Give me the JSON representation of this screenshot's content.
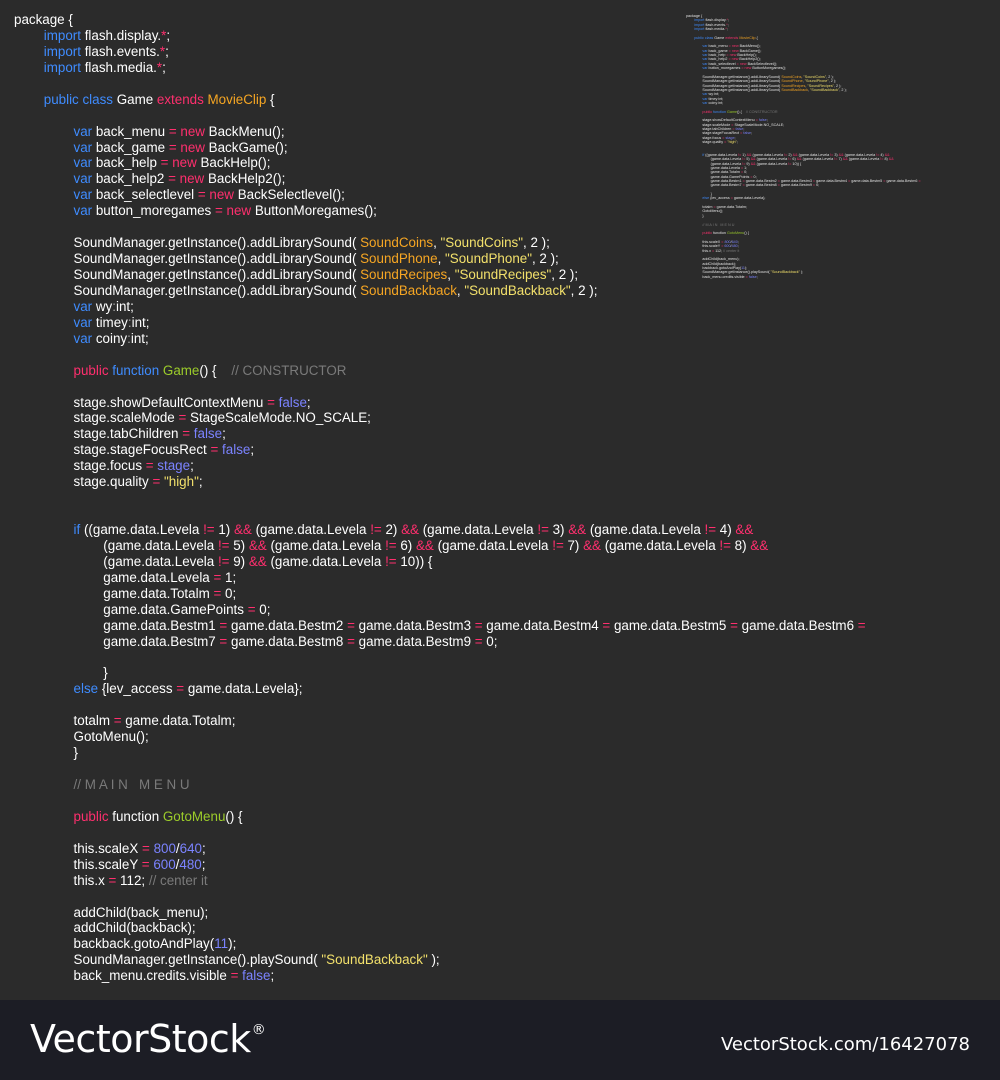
{
  "colors": {
    "background": "#2b2b2b",
    "keyword": "#3f8cff",
    "operator": "#ff2f6e",
    "classname": "#f6a623",
    "function_name": "#9ccc2a",
    "string": "#f2e06b",
    "number": "#7b83ff",
    "comment": "#7a7a7a",
    "footer": "#1c1d25"
  },
  "code_lines": [
    [
      [
        "t",
        "package {"
      ]
    ],
    [
      [
        "t",
        "        "
      ],
      [
        "k",
        "import"
      ],
      [
        "t",
        " flash.display."
      ],
      [
        "m",
        "*"
      ],
      [
        "t",
        ";"
      ]
    ],
    [
      [
        "t",
        "        "
      ],
      [
        "k",
        "import"
      ],
      [
        "t",
        " flash.events."
      ],
      [
        "m",
        "*"
      ],
      [
        "t",
        ";"
      ]
    ],
    [
      [
        "t",
        "        "
      ],
      [
        "k",
        "import"
      ],
      [
        "t",
        " flash.media."
      ],
      [
        "m",
        "*"
      ],
      [
        "t",
        ";"
      ]
    ],
    [
      [
        "t",
        ""
      ]
    ],
    [
      [
        "t",
        "        "
      ],
      [
        "k",
        "public class"
      ],
      [
        "t",
        " Game "
      ],
      [
        "m",
        "extends"
      ],
      [
        "t",
        " "
      ],
      [
        "c",
        "MovieClip"
      ],
      [
        "t",
        " {"
      ]
    ],
    [
      [
        "t",
        ""
      ]
    ],
    [
      [
        "t",
        "                "
      ],
      [
        "k",
        "var"
      ],
      [
        "t",
        " back_menu "
      ],
      [
        "m",
        "="
      ],
      [
        "t",
        " "
      ],
      [
        "m",
        "new"
      ],
      [
        "t",
        " BackMenu();"
      ]
    ],
    [
      [
        "t",
        "                "
      ],
      [
        "k",
        "var"
      ],
      [
        "t",
        " back_game "
      ],
      [
        "m",
        "="
      ],
      [
        "t",
        " "
      ],
      [
        "m",
        "new"
      ],
      [
        "t",
        " BackGame();"
      ]
    ],
    [
      [
        "t",
        "                "
      ],
      [
        "k",
        "var"
      ],
      [
        "t",
        " back_help "
      ],
      [
        "m",
        "="
      ],
      [
        "t",
        " "
      ],
      [
        "m",
        "new"
      ],
      [
        "t",
        " BackHelp();"
      ]
    ],
    [
      [
        "t",
        "                "
      ],
      [
        "k",
        "var"
      ],
      [
        "t",
        " back_help2 "
      ],
      [
        "m",
        "="
      ],
      [
        "t",
        " "
      ],
      [
        "m",
        "new"
      ],
      [
        "t",
        " BackHelp2();"
      ]
    ],
    [
      [
        "t",
        "                "
      ],
      [
        "k",
        "var"
      ],
      [
        "t",
        " back_selectlevel "
      ],
      [
        "m",
        "="
      ],
      [
        "t",
        " "
      ],
      [
        "m",
        "new"
      ],
      [
        "t",
        " BackSelectlevel();"
      ]
    ],
    [
      [
        "t",
        "                "
      ],
      [
        "k",
        "var"
      ],
      [
        "t",
        " button_moregames "
      ],
      [
        "m",
        "="
      ],
      [
        "t",
        " "
      ],
      [
        "m",
        "new"
      ],
      [
        "t",
        " ButtonMoregames();"
      ]
    ],
    [
      [
        "t",
        ""
      ]
    ],
    [
      [
        "t",
        "                SoundManager.getInstance().addLibrarySound( "
      ],
      [
        "c",
        "SoundCoins"
      ],
      [
        "t",
        ", "
      ],
      [
        "s",
        "\"SoundCoins\""
      ],
      [
        "t",
        ", 2 );"
      ]
    ],
    [
      [
        "t",
        "                SoundManager.getInstance().addLibrarySound( "
      ],
      [
        "c",
        "SoundPhone"
      ],
      [
        "t",
        ", "
      ],
      [
        "s",
        "\"SoundPhone\""
      ],
      [
        "t",
        ", 2 );"
      ]
    ],
    [
      [
        "t",
        "                SoundManager.getInstance().addLibrarySound( "
      ],
      [
        "c",
        "SoundRecipes"
      ],
      [
        "t",
        ", "
      ],
      [
        "s",
        "\"SoundRecipes\""
      ],
      [
        "t",
        ", 2 );"
      ]
    ],
    [
      [
        "t",
        "                SoundManager.getInstance().addLibrarySound( "
      ],
      [
        "c",
        "SoundBackback"
      ],
      [
        "t",
        ", "
      ],
      [
        "s",
        "\"SoundBackback\""
      ],
      [
        "t",
        ", 2 );"
      ]
    ],
    [
      [
        "t",
        "                "
      ],
      [
        "k",
        "var"
      ],
      [
        "t",
        " wy"
      ],
      [
        "i",
        ":"
      ],
      [
        "t",
        "int;"
      ]
    ],
    [
      [
        "t",
        "                "
      ],
      [
        "k",
        "var"
      ],
      [
        "t",
        " timey"
      ],
      [
        "i",
        ":"
      ],
      [
        "t",
        "int;"
      ]
    ],
    [
      [
        "t",
        "                "
      ],
      [
        "k",
        "var"
      ],
      [
        "t",
        " coiny"
      ],
      [
        "i",
        ":"
      ],
      [
        "t",
        "int;"
      ]
    ],
    [
      [
        "t",
        ""
      ]
    ],
    [
      [
        "t",
        "                "
      ],
      [
        "m",
        "public"
      ],
      [
        "t",
        " "
      ],
      [
        "k",
        "function"
      ],
      [
        "t",
        " "
      ],
      [
        "g",
        "Game"
      ],
      [
        "t",
        "() {    "
      ],
      [
        "cm",
        "// CONSTRUCTOR"
      ]
    ],
    [
      [
        "t",
        ""
      ]
    ],
    [
      [
        "t",
        "                stage.showDefaultContextMenu "
      ],
      [
        "m",
        "="
      ],
      [
        "t",
        " "
      ],
      [
        "n",
        "false"
      ],
      [
        "t",
        ";"
      ]
    ],
    [
      [
        "t",
        "                stage.scaleMode "
      ],
      [
        "m",
        "="
      ],
      [
        "t",
        " StageScaleMode.NO_SCALE;"
      ]
    ],
    [
      [
        "t",
        "                stage.tabChildren "
      ],
      [
        "m",
        "="
      ],
      [
        "t",
        " "
      ],
      [
        "n",
        "false"
      ],
      [
        "t",
        ";"
      ]
    ],
    [
      [
        "t",
        "                stage.stageFocusRect "
      ],
      [
        "m",
        "="
      ],
      [
        "t",
        " "
      ],
      [
        "n",
        "false"
      ],
      [
        "t",
        ";"
      ]
    ],
    [
      [
        "t",
        "                stage.focus "
      ],
      [
        "m",
        "="
      ],
      [
        "t",
        " "
      ],
      [
        "n",
        "stage"
      ],
      [
        "t",
        ";"
      ]
    ],
    [
      [
        "t",
        "                stage.quality "
      ],
      [
        "m",
        "="
      ],
      [
        "t",
        " "
      ],
      [
        "s",
        "\"high\""
      ],
      [
        "t",
        ";"
      ]
    ],
    [
      [
        "t",
        ""
      ]
    ],
    [
      [
        "t",
        ""
      ]
    ],
    [
      [
        "t",
        "                "
      ],
      [
        "k",
        "if"
      ],
      [
        "t",
        " ((game.data.Levela "
      ],
      [
        "m",
        "!="
      ],
      [
        "t",
        " 1) "
      ],
      [
        "m",
        "&&"
      ],
      [
        "t",
        " (game.data.Levela "
      ],
      [
        "m",
        "!="
      ],
      [
        "t",
        " 2) "
      ],
      [
        "m",
        "&&"
      ],
      [
        "t",
        " (game.data.Levela "
      ],
      [
        "m",
        "!="
      ],
      [
        "t",
        " 3) "
      ],
      [
        "m",
        "&&"
      ],
      [
        "t",
        " (game.data.Levela "
      ],
      [
        "m",
        "!="
      ],
      [
        "t",
        " 4) "
      ],
      [
        "m",
        "&&"
      ]
    ],
    [
      [
        "t",
        "                        (game.data.Levela "
      ],
      [
        "m",
        "!="
      ],
      [
        "t",
        " 5) "
      ],
      [
        "m",
        "&&"
      ],
      [
        "t",
        " (game.data.Levela "
      ],
      [
        "m",
        "!="
      ],
      [
        "t",
        " 6) "
      ],
      [
        "m",
        "&&"
      ],
      [
        "t",
        " (game.data.Levela "
      ],
      [
        "m",
        "!="
      ],
      [
        "t",
        " 7) "
      ],
      [
        "m",
        "&&"
      ],
      [
        "t",
        " (game.data.Levela "
      ],
      [
        "m",
        "!="
      ],
      [
        "t",
        " 8) "
      ],
      [
        "m",
        "&&"
      ]
    ],
    [
      [
        "t",
        "                        (game.data.Levela "
      ],
      [
        "m",
        "!="
      ],
      [
        "t",
        " 9) "
      ],
      [
        "m",
        "&&"
      ],
      [
        "t",
        " (game.data.Levela "
      ],
      [
        "m",
        "!="
      ],
      [
        "t",
        " 10)) {"
      ]
    ],
    [
      [
        "t",
        "                        game.data.Levela "
      ],
      [
        "m",
        "="
      ],
      [
        "t",
        " 1;"
      ]
    ],
    [
      [
        "t",
        "                        game.data.Totalm "
      ],
      [
        "m",
        "="
      ],
      [
        "t",
        " 0;"
      ]
    ],
    [
      [
        "t",
        "                        game.data.GamePoints "
      ],
      [
        "m",
        "="
      ],
      [
        "t",
        " 0;"
      ]
    ],
    [
      [
        "t",
        "                        game.data.Bestm1 "
      ],
      [
        "m",
        "="
      ],
      [
        "t",
        " game.data.Bestm2 "
      ],
      [
        "m",
        "="
      ],
      [
        "t",
        " game.data.Bestm3 "
      ],
      [
        "m",
        "="
      ],
      [
        "t",
        " game.data.Bestm4 "
      ],
      [
        "m",
        "="
      ],
      [
        "t",
        " game.data.Bestm5 "
      ],
      [
        "m",
        "="
      ],
      [
        "t",
        " game.data.Bestm6 "
      ],
      [
        "m",
        "="
      ]
    ],
    [
      [
        "t",
        "                        game.data.Bestm7 "
      ],
      [
        "m",
        "="
      ],
      [
        "t",
        " game.data.Bestm8 "
      ],
      [
        "m",
        "="
      ],
      [
        "t",
        " game.data.Bestm9 "
      ],
      [
        "m",
        "="
      ],
      [
        "t",
        " 0;"
      ]
    ],
    [
      [
        "t",
        ""
      ]
    ],
    [
      [
        "t",
        "                        }"
      ]
    ],
    [
      [
        "t",
        "                "
      ],
      [
        "k",
        "else"
      ],
      [
        "t",
        " {lev_access "
      ],
      [
        "m",
        "="
      ],
      [
        "t",
        " game.data.Levela};"
      ]
    ],
    [
      [
        "t",
        ""
      ]
    ],
    [
      [
        "t",
        "                totalm "
      ],
      [
        "m",
        "="
      ],
      [
        "t",
        " game.data.Totalm;"
      ]
    ],
    [
      [
        "t",
        "                GotoMenu();"
      ]
    ],
    [
      [
        "t",
        "                }"
      ]
    ],
    [
      [
        "t",
        ""
      ]
    ],
    [
      [
        "t",
        "                "
      ],
      [
        "cm",
        "// M A I N   M E N U"
      ]
    ],
    [
      [
        "t",
        ""
      ]
    ],
    [
      [
        "t",
        "                "
      ],
      [
        "m",
        "public"
      ],
      [
        "t",
        " function "
      ],
      [
        "g",
        "GotoMenu"
      ],
      [
        "t",
        "() {"
      ]
    ],
    [
      [
        "t",
        ""
      ]
    ],
    [
      [
        "t",
        "                this.scaleX "
      ],
      [
        "m",
        "="
      ],
      [
        "t",
        " "
      ],
      [
        "n",
        "800"
      ],
      [
        "t",
        "/"
      ],
      [
        "n",
        "640"
      ],
      [
        "t",
        ";"
      ]
    ],
    [
      [
        "t",
        "                this.scaleY "
      ],
      [
        "m",
        "="
      ],
      [
        "t",
        " "
      ],
      [
        "n",
        "600"
      ],
      [
        "t",
        "/"
      ],
      [
        "n",
        "480"
      ],
      [
        "t",
        ";"
      ]
    ],
    [
      [
        "t",
        "                this.x "
      ],
      [
        "m",
        "="
      ],
      [
        "t",
        " 112; "
      ],
      [
        "cm",
        "// center it"
      ]
    ],
    [
      [
        "t",
        ""
      ]
    ],
    [
      [
        "t",
        "                addChild(back_menu);"
      ]
    ],
    [
      [
        "t",
        "                addChild(backback);"
      ]
    ],
    [
      [
        "t",
        "                backback.gotoAndPlay("
      ],
      [
        "n",
        "11"
      ],
      [
        "t",
        ");"
      ]
    ],
    [
      [
        "t",
        "                SoundManager.getInstance().playSound( "
      ],
      [
        "s",
        "\"SoundBackback\""
      ],
      [
        "t",
        " );"
      ]
    ],
    [
      [
        "t",
        "                back_menu.credits.visible "
      ],
      [
        "m",
        "="
      ],
      [
        "t",
        " "
      ],
      [
        "n",
        "false"
      ],
      [
        "t",
        ";"
      ]
    ]
  ],
  "footer": {
    "brand": "VectorStock",
    "registered": "®",
    "image_id": "VectorStock.com/16427078"
  }
}
